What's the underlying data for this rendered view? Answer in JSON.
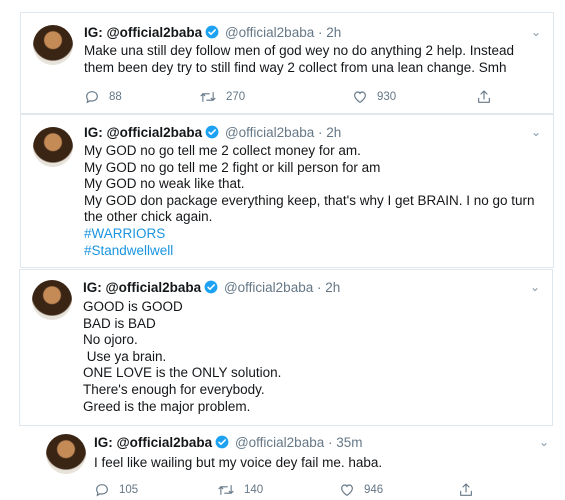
{
  "tweets": [
    {
      "display_name": "IG: @official2baba",
      "handle": "@official2baba · 2h",
      "lines": [
        "Make una still dey follow men of god wey no do anything 2 help. Instead",
        "them been dey try to still find way 2 collect from una lean change. Smh"
      ],
      "replies": "88",
      "retweets": "270",
      "likes": "930"
    },
    {
      "display_name": "IG: @official2baba",
      "handle": "@official2baba · 2h",
      "lines": [
        "My GOD no go tell me 2 collect money for am.",
        "My GOD no go tell me 2 fight or kill person for am",
        "My GOD no weak like that.",
        "My GOD don package everything keep, that's why I get BRAIN. I no go turn",
        "the other chick again."
      ],
      "hashtags": [
        "#WARRIORS",
        "#Standwellwell"
      ]
    },
    {
      "display_name": "IG: @official2baba",
      "handle": "@official2baba · 2h",
      "lines": [
        "GOOD is GOOD",
        "BAD is BAD",
        "No ojoro.",
        " Use ya brain.",
        "ONE LOVE is the ONLY solution.",
        "There's enough for everybody.",
        "Greed is the major problem."
      ]
    },
    {
      "display_name": "IG: @official2baba",
      "handle": "@official2baba · 35m",
      "lines": [
        "I feel like wailing but my voice dey fail me. haba."
      ],
      "replies": "105",
      "retweets": "140",
      "likes": "946"
    }
  ],
  "icons": {
    "reply": "reply-icon",
    "retweet": "retweet-icon",
    "like": "heart-icon",
    "share": "share-icon",
    "verified": "verified-badge-icon",
    "more": "chevron-down-icon"
  },
  "colors": {
    "link": "#1b95e0",
    "verified": "#1da1f2",
    "muted": "#657786",
    "border": "#e1e8ed"
  }
}
